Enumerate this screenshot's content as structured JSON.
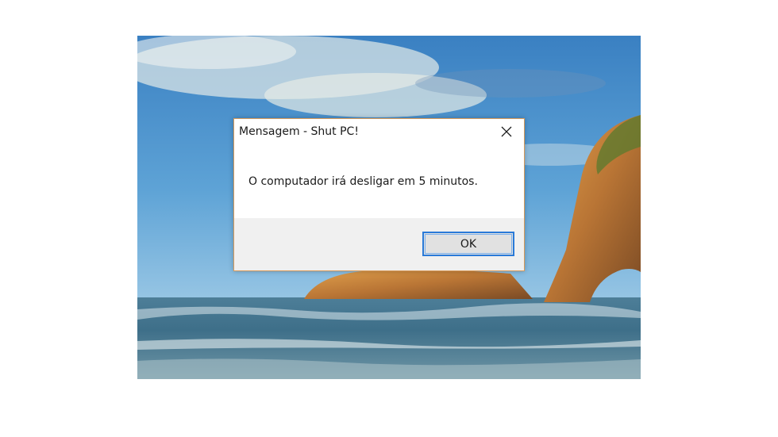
{
  "dialog": {
    "title": "Mensagem - Shut PC!",
    "message": "O computador irá desligar em 5 minutos.",
    "ok_label": "OK",
    "close_icon": "close-icon"
  },
  "colors": {
    "dialog_border": "#d79a5a",
    "ok_button_border": "#2a7ad8",
    "footer_background": "#f0f0f0"
  }
}
